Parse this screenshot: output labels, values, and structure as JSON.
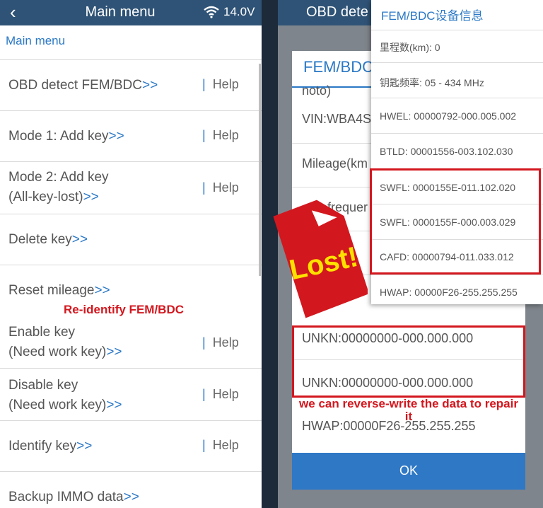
{
  "left": {
    "header": {
      "back_icon": "back-arrow-icon",
      "title": "Main menu",
      "wifi_icon": "wifi-icon",
      "voltage": "14.0V"
    },
    "breadcrumb": "Main menu",
    "arrow": ">>",
    "help": "Help",
    "help_separator": "|",
    "items": [
      {
        "line1": "OBD detect FEM/BDC",
        "line2": "",
        "help": true
      },
      {
        "line1": "Mode 1: Add key",
        "line2": "",
        "help": true
      },
      {
        "line1": "Mode 2: Add key",
        "line2": "(All-key-lost)",
        "help": true
      },
      {
        "line1": "Delete key",
        "line2": "",
        "help": false
      },
      {
        "line1": "Reset mileage",
        "line2": "",
        "help": false
      },
      {
        "line1": "Enable key",
        "line2": "(Need work key)",
        "help": true
      },
      {
        "line1": "Disable key",
        "line2": "(Need work key)",
        "help": true
      },
      {
        "line1": "Identify key",
        "line2": "",
        "help": true
      },
      {
        "line1": "Backup IMMO data",
        "line2": "",
        "help": false
      }
    ],
    "annotation": "Re-identify FEM/BDC"
  },
  "right": {
    "header_title": "OBD dete",
    "dialog": {
      "title": "FEM/BDC",
      "rows": [
        "noto)",
        "VIN:WBA4S",
        "Mileage(km",
        "frequer",
        "",
        "",
        "UNKN:00000000-000.000.000",
        "UNKN:00000000-000.000.000",
        "HWAP:00000F26-255.255.255"
      ],
      "ok": "OK"
    },
    "popup": {
      "title": "FEM/BDC设备信息",
      "rows": [
        "里程数(km): 0",
        "钥匙频率: 05 - 434 MHz",
        "HWEL: 00000792-000.005.002",
        "BTLD: 00001556-003.102.030",
        "SWFL: 0000155E-011.102.020",
        "SWFL: 0000155F-000.003.029",
        "CAFD: 00000794-011.033.012",
        "HWAP: 00000F26-255.255.255"
      ]
    },
    "lost_badge": "Lost!",
    "annotation": "we can reverse-write the data to repair it"
  },
  "colors": {
    "header": "#2f5376",
    "accent": "#2a78c6",
    "annotation_red": "#d3171e"
  }
}
